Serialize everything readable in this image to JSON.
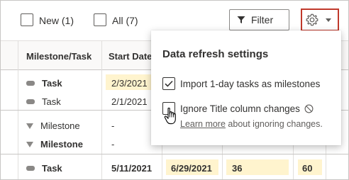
{
  "toolbar": {
    "new_label": "New (1)",
    "all_label": "All (7)",
    "filter_label": "Filter",
    "filter_icon": "funnel-icon",
    "settings_icon": "gear-icon",
    "dropdown_icon": "chevron-down-icon",
    "highlight_color": "#c0392b"
  },
  "grid": {
    "columns": [
      "Milestone/Task",
      "Start Date"
    ],
    "rows": [
      {
        "type": "task",
        "name": "Task",
        "bold": true,
        "start": "2/3/2021",
        "start_highlight": true
      },
      {
        "type": "task",
        "name": "Task",
        "bold": false,
        "start": "2/1/2021",
        "start_highlight": false
      },
      {
        "type": "milestone",
        "name": "Milestone",
        "bold": false,
        "start": "-"
      },
      {
        "type": "milestone",
        "name": "Milestone",
        "bold": true,
        "start": "-"
      },
      {
        "type": "task",
        "name": "Task",
        "bold": true,
        "start": "5/11/2021",
        "end": "6/29/2021",
        "duration": "36",
        "percent": "60"
      }
    ],
    "highlight_color": "#fff4ce"
  },
  "popup": {
    "title": "Data refresh settings",
    "option1_label": "Import 1-day tasks as milestones",
    "option1_checked": true,
    "option2_label": "Ignore Title column changes",
    "option2_checked": false,
    "info_icon": "circle-slash-icon",
    "learn_more_link": "Learn more",
    "learn_more_suffix": " about ignoring changes."
  }
}
